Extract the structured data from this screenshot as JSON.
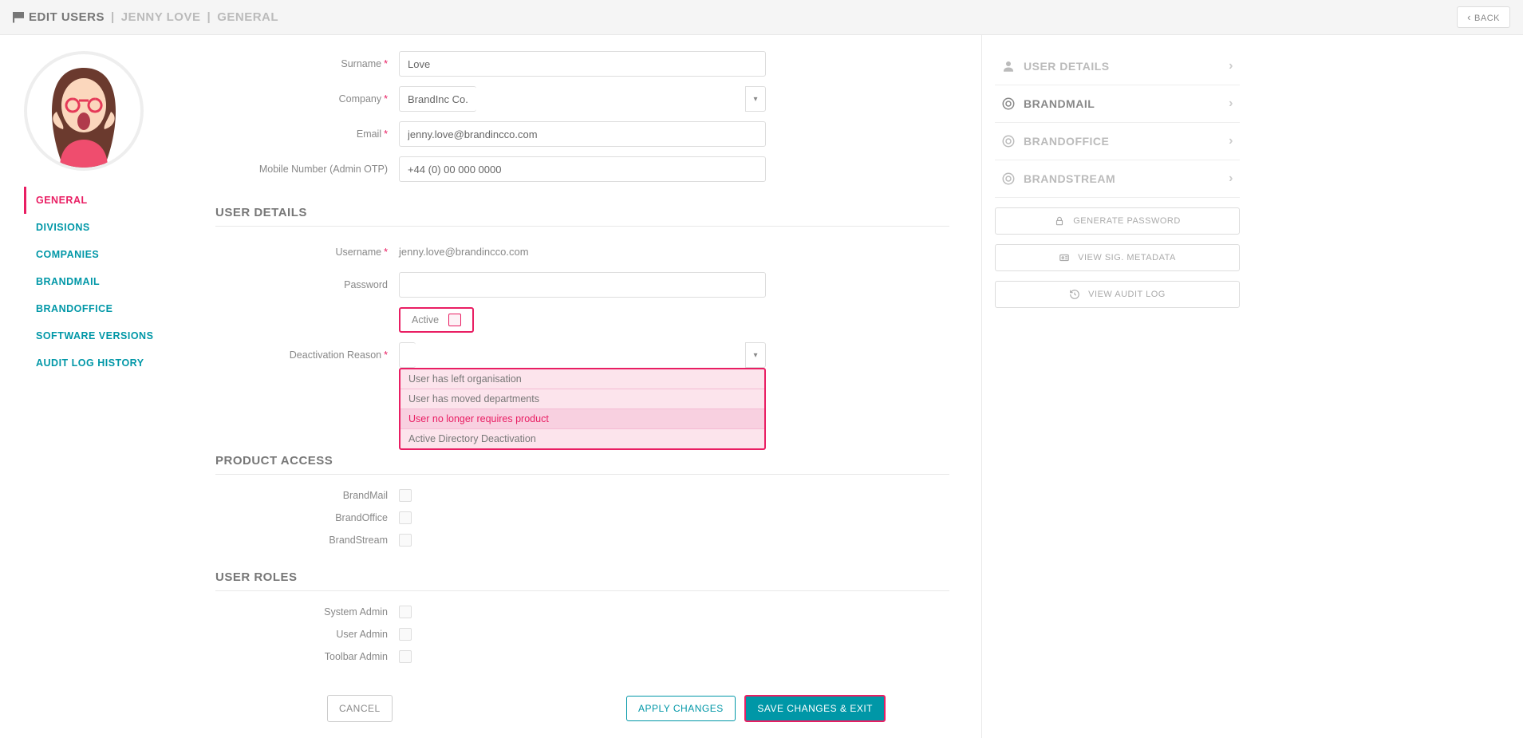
{
  "header": {
    "crumb1": "EDIT USERS",
    "crumb2": "JENNY LOVE",
    "crumb3": "GENERAL",
    "back": "BACK"
  },
  "leftNav": {
    "items": [
      {
        "label": "GENERAL",
        "active": true
      },
      {
        "label": "DIVISIONS"
      },
      {
        "label": "COMPANIES"
      },
      {
        "label": "BRANDMAIL"
      },
      {
        "label": "BRANDOFFICE"
      },
      {
        "label": "SOFTWARE VERSIONS"
      },
      {
        "label": "AUDIT LOG HISTORY"
      }
    ]
  },
  "form": {
    "surname_label": "Surname",
    "surname_value": "Love",
    "company_label": "Company",
    "company_value": "BrandInc Co.",
    "email_label": "Email",
    "email_value": "jenny.love@brandincco.com",
    "mobile_label": "Mobile Number (Admin OTP)",
    "mobile_value": "+44 (0) 00 000 0000",
    "section_user_details": "USER DETAILS",
    "username_label": "Username",
    "username_value": "jenny.love@brandincco.com",
    "password_label": "Password",
    "password_value": "",
    "active_label": "Active",
    "deactivation_label": "Deactivation Reason",
    "deactivation_value": "",
    "deactivation_options": [
      "User has left organisation",
      "User has moved departments",
      "User no longer requires product",
      "Active Directory Deactivation"
    ],
    "section_product_access": "PRODUCT ACCESS",
    "brandmail_label": "BrandMail",
    "brandoffice_label": "BrandOffice",
    "brandstream_label": "BrandStream",
    "section_user_roles": "USER ROLES",
    "sysadmin_label": "System Admin",
    "useradmin_label": "User Admin",
    "toolbaradmin_label": "Toolbar Admin"
  },
  "footer": {
    "cancel": "CANCEL",
    "apply": "APPLY CHANGES",
    "save": "SAVE CHANGES & EXIT"
  },
  "rightPanel": {
    "items": [
      {
        "label": "USER DETAILS",
        "icon": "user"
      },
      {
        "label": "BRANDMAIL",
        "icon": "target",
        "on": true
      },
      {
        "label": "BRANDOFFICE",
        "icon": "target"
      },
      {
        "label": "BRANDSTREAM",
        "icon": "target"
      }
    ],
    "buttons": [
      {
        "label": "GENERATE PASSWORD",
        "icon": "lock"
      },
      {
        "label": "VIEW SIG. METADATA",
        "icon": "card"
      },
      {
        "label": "VIEW AUDIT LOG",
        "icon": "history"
      }
    ]
  }
}
